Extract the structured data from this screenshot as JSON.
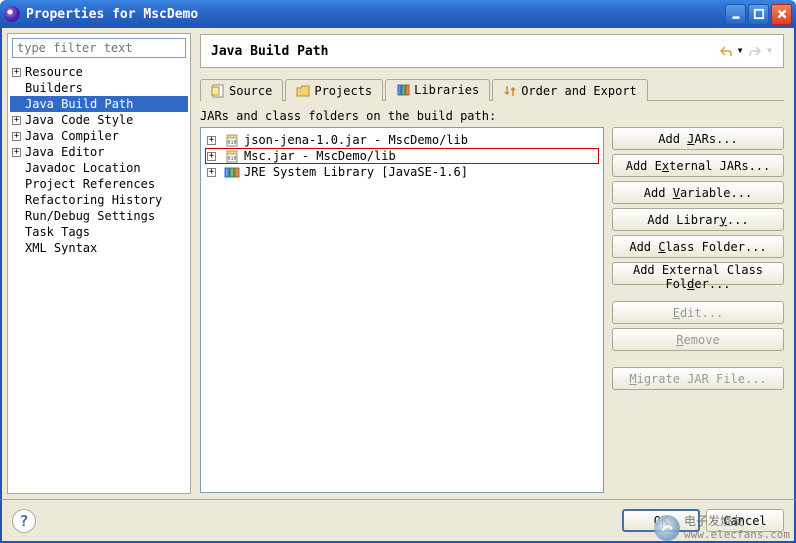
{
  "window": {
    "title": "Properties for MscDemo"
  },
  "filter": {
    "placeholder": "type filter text"
  },
  "tree": {
    "items": [
      {
        "label": "Resource",
        "expandable": true,
        "indent": 0
      },
      {
        "label": "Builders",
        "expandable": false,
        "indent": 0
      },
      {
        "label": "Java Build Path",
        "expandable": false,
        "indent": 0,
        "selected": true
      },
      {
        "label": "Java Code Style",
        "expandable": true,
        "indent": 0
      },
      {
        "label": "Java Compiler",
        "expandable": true,
        "indent": 0
      },
      {
        "label": "Java Editor",
        "expandable": true,
        "indent": 0
      },
      {
        "label": "Javadoc Location",
        "expandable": false,
        "indent": 0
      },
      {
        "label": "Project References",
        "expandable": false,
        "indent": 0
      },
      {
        "label": "Refactoring History",
        "expandable": false,
        "indent": 0
      },
      {
        "label": "Run/Debug Settings",
        "expandable": false,
        "indent": 0
      },
      {
        "label": "Task Tags",
        "expandable": false,
        "indent": 0
      },
      {
        "label": "XML Syntax",
        "expandable": false,
        "indent": 0
      }
    ]
  },
  "page": {
    "title": "Java Build Path"
  },
  "tabs": [
    {
      "label": "Source",
      "icon": "source"
    },
    {
      "label": "Projects",
      "icon": "projects"
    },
    {
      "label": "Libraries",
      "icon": "libraries",
      "active": true
    },
    {
      "label": "Order and Export",
      "icon": "order"
    }
  ],
  "libraries": {
    "label": "JARs and class folders on the build path:",
    "items": [
      {
        "label": "json-jena-1.0.jar - MscDemo/lib",
        "icon": "jar"
      },
      {
        "label": "Msc.jar - MscDemo/lib",
        "icon": "jar",
        "highlighted": true
      },
      {
        "label": "JRE System Library [JavaSE-1.6]",
        "icon": "jre"
      }
    ]
  },
  "buttons": {
    "add_jars": "Add JARs...",
    "add_external_jars": "Add External JARs...",
    "add_variable": "Add Variable...",
    "add_library": "Add Library...",
    "add_class_folder": "Add Class Folder...",
    "add_external_class_folder": "Add External Class Folder...",
    "edit": "Edit...",
    "remove": "Remove",
    "migrate": "Migrate JAR File..."
  },
  "footer": {
    "ok": "OK",
    "cancel": "Cancel"
  },
  "watermark": {
    "line1": "电子发烧友",
    "line2": "www.elecfans.com"
  }
}
